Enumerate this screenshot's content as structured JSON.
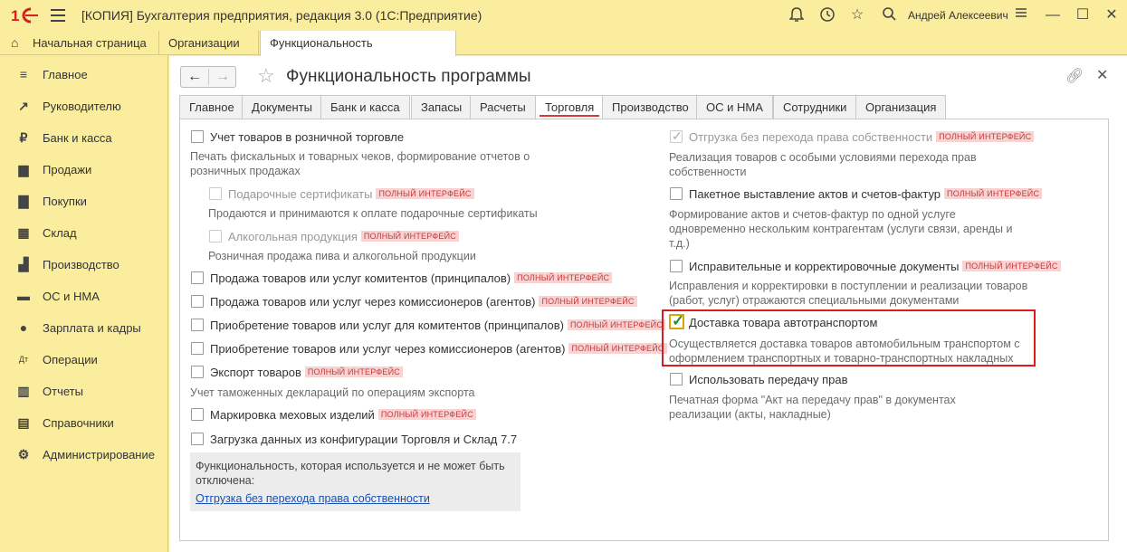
{
  "window": {
    "title": "[КОПИЯ] Бухгалтерия предприятия, редакция 3.0  (1С:Предприятие)",
    "user": "Андрей Алексеевич"
  },
  "tabs": [
    {
      "label": "Начальная страница"
    },
    {
      "label": "Организации"
    },
    {
      "label": "Функциональность программы"
    }
  ],
  "sidebar": {
    "items": [
      {
        "label": "Главное",
        "icon": "list-icon"
      },
      {
        "label": "Руководителю",
        "icon": "trend-icon"
      },
      {
        "label": "Банк и касса",
        "icon": "ruble-icon"
      },
      {
        "label": "Продажи",
        "icon": "cart-icon"
      },
      {
        "label": "Покупки",
        "icon": "basket-icon"
      },
      {
        "label": "Склад",
        "icon": "warehouse-icon"
      },
      {
        "label": "Производство",
        "icon": "factory-icon"
      },
      {
        "label": "ОС и НМА",
        "icon": "truck-icon"
      },
      {
        "label": "Зарплата и кадры",
        "icon": "person-icon"
      },
      {
        "label": "Операции",
        "icon": "dt-kt-icon"
      },
      {
        "label": "Отчеты",
        "icon": "bar-chart-icon"
      },
      {
        "label": "Справочники",
        "icon": "book-icon"
      },
      {
        "label": "Администрирование",
        "icon": "gear-icon"
      }
    ]
  },
  "page": {
    "title": "Функциональность программы"
  },
  "form_tabs": [
    {
      "label": "Главное"
    },
    {
      "label": "Документы"
    },
    {
      "label": "Банк и касса"
    },
    {
      "label": "Запасы"
    },
    {
      "label": "Расчеты"
    },
    {
      "label": "Торговля"
    },
    {
      "label": "Производство"
    },
    {
      "label": "ОС и НМА"
    },
    {
      "label": "Сотрудники"
    },
    {
      "label": "Организация"
    }
  ],
  "badge_text": "ПОЛНЫЙ ИНТЕРФЕЙС",
  "left": {
    "retail": {
      "label": "Учет товаров в розничной торговле",
      "desc": "Печать фискальных и товарных чеков, формирование отчетов о розничных продажах"
    },
    "gift": {
      "label": "Подарочные сертификаты",
      "desc": "Продаются и принимаются к оплате подарочные сертификаты"
    },
    "alcohol": {
      "label": "Алкогольная продукция",
      "desc": "Розничная продажа пива и алкогольной продукции"
    },
    "opt1": {
      "label": "Продажа товаров или услуг комитентов (принципалов)"
    },
    "opt2": {
      "label": "Продажа товаров или услуг через комиссионеров (агентов)"
    },
    "opt3": {
      "label": "Приобретение товаров или услуг для комитентов (принципалов)"
    },
    "opt4": {
      "label": "Приобретение товаров или услуг через комиссионеров (агентов)"
    },
    "export": {
      "label": "Экспорт товаров",
      "desc": "Учет таможенных деклараций по операциям экспорта"
    },
    "fur": {
      "label": "Маркировка меховых изделий"
    },
    "load77": {
      "label": "Загрузка данных из конфигурации Торговля и Склад 7.7"
    },
    "note": {
      "text": "Функциональность, которая используется и не может быть отключена:",
      "link": "Отгрузка без перехода права собственности"
    }
  },
  "right": {
    "ship": {
      "label": "Отгрузка без перехода права собственности",
      "desc": "Реализация товаров с особыми условиями перехода прав собственности"
    },
    "batch": {
      "label": "Пакетное выставление актов и счетов-фактур",
      "desc": "Формирование актов и счетов-фактур по одной услуге одновременно нескольким контрагентам (услуги связи, аренды и т.д.)"
    },
    "correct": {
      "label": "Исправительные и корректировочные документы",
      "desc": "Исправления и корректировки в поступлении и реализации товаров (работ, услуг) отражаются специальными документами"
    },
    "delivery": {
      "label": "Доставка товара автотранспортом",
      "desc": "Осуществляется доставка товаров автомобильным транспортом с оформлением транспортных и товарно-транспортных накладных"
    },
    "rights": {
      "label": "Использовать передачу прав",
      "desc": "Печатная форма \"Акт на передачу прав\" в документах реализации (акты, накладные)"
    }
  }
}
